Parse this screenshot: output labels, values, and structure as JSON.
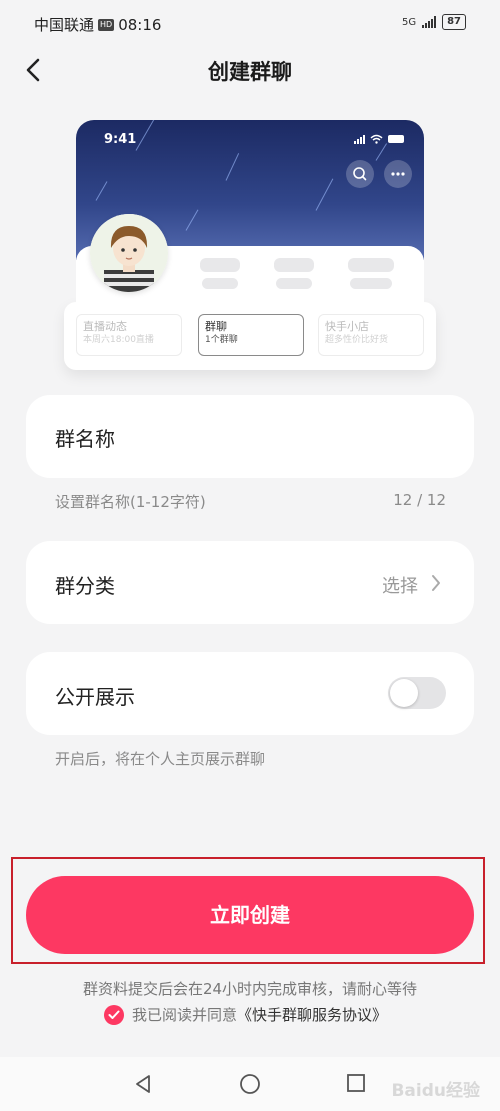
{
  "status_bar": {
    "carrier": "中国联通",
    "hd_badge": "HD",
    "time": "08:16",
    "network": "5G",
    "battery": "87"
  },
  "header": {
    "title": "创建群聊"
  },
  "preview": {
    "time": "9:41",
    "tabs": [
      {
        "title": "直播动态",
        "subtitle": "本周六18:00直播"
      },
      {
        "title": "群聊",
        "subtitle": "1个群聊"
      },
      {
        "title": "快手小店",
        "subtitle": "超多性价比好货"
      }
    ]
  },
  "form": {
    "group_name": {
      "label": "群名称",
      "hint": "设置群名称(1-12字符)",
      "counter": "12 / 12"
    },
    "group_category": {
      "label": "群分类",
      "value": "选择"
    },
    "public_display": {
      "label": "公开展示",
      "enabled": false,
      "hint": "开启后，将在个人主页展示群聊"
    }
  },
  "actions": {
    "create_label": "立即创建",
    "review_note": "群资料提交后会在24小时内完成审核，请耐心等待",
    "agree_prefix": "我已阅读并同意",
    "agreement_link": "《快手群聊服务协议》"
  },
  "watermark": "Baidu经验",
  "colors": {
    "accent": "#fd3862",
    "background": "#f4f4f5"
  }
}
